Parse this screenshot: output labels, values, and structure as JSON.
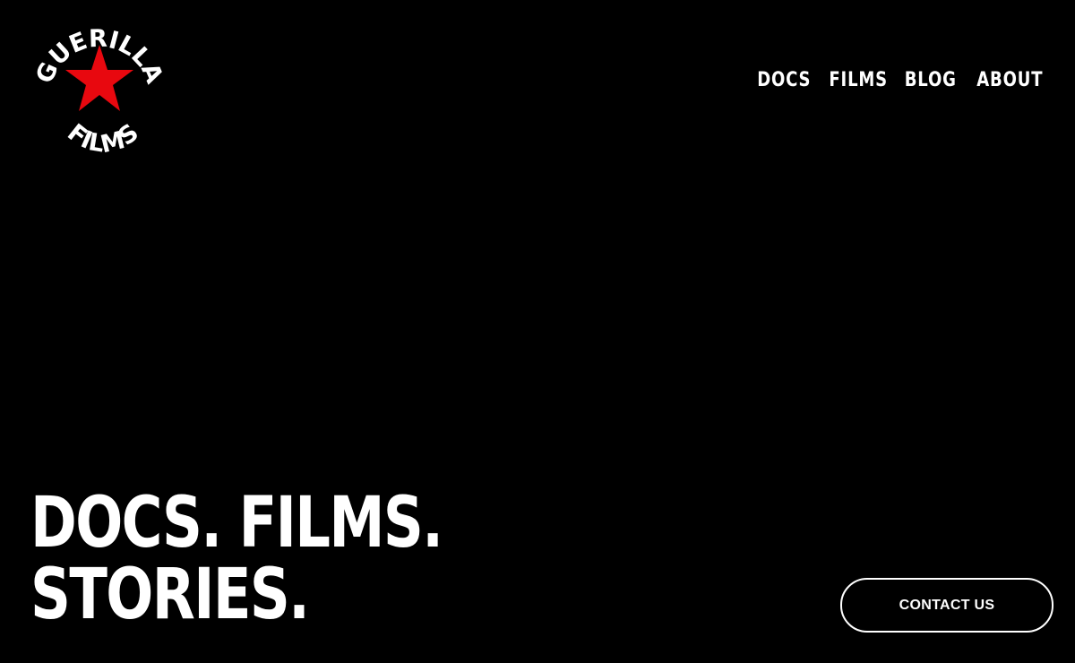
{
  "brand": {
    "logo_text_top": "GUERILLA",
    "logo_text_bottom": "FILMS",
    "star_color": "#e8080f"
  },
  "nav": {
    "items": [
      {
        "label": "DOCS"
      },
      {
        "label": "FILMS"
      },
      {
        "label": "BLOG"
      },
      {
        "label": "ABOUT"
      }
    ]
  },
  "hero": {
    "line1": "DOCS. FILMS.",
    "line2": "STORIES."
  },
  "cta": {
    "label": "CONTACT US"
  },
  "colors": {
    "background": "#000000",
    "text": "#ffffff",
    "accent": "#e8080f"
  }
}
